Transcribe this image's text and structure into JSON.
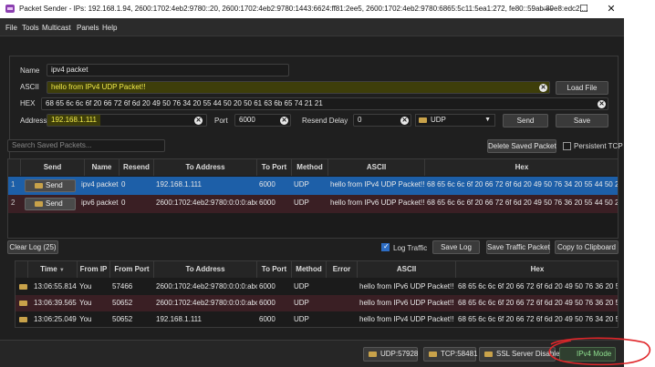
{
  "window": {
    "title": "Packet Sender - IPs: 192.168.1.94, 2600:1702:4eb2:9780::20, 2600:1702:4eb2:9780:1443:6624:ff81:2ee5, 2600:1702:4eb2:9780:6865:5c11:5ea1:272, fe80::59ab:89e8:edc2:...",
    "controls": {
      "minimize": "—",
      "maximize": "☐",
      "close": "✕"
    }
  },
  "menu": [
    "File",
    "Tools",
    "Multicast",
    "Panels",
    "Help"
  ],
  "form": {
    "name_label": "Name",
    "name_value": "ipv4 packet",
    "ascii_label": "ASCII",
    "ascii_value": "hello from IPv4 UDP Packet!!",
    "load_file": "Load File",
    "hex_label": "HEX",
    "hex_value": "68 65 6c 6c 6f 20 66 72 6f 6d 20 49 50 76 34 20 55 44 50 20 50 61 63 6b 65 74 21 21",
    "address_label": "Address",
    "address_value": "192.168.1.111",
    "port_label": "Port",
    "port_value": "6000",
    "resend_label": "Resend Delay",
    "resend_value": "0",
    "protocol": "UDP",
    "send": "Send",
    "save": "Save"
  },
  "saved": {
    "search_placeholder": "Search Saved Packets...",
    "delete_btn": "Delete Saved Packet",
    "persistent_label": "Persistent TCP",
    "headers": [
      "Send",
      "Name",
      "Resend",
      "To Address",
      "To Port",
      "Method",
      "ASCII",
      "Hex"
    ],
    "rows": [
      {
        "num": "1",
        "send": "Send",
        "name": "ipv4 packet",
        "resend": "0",
        "to": "192.168.1.111",
        "port": "6000",
        "method": "UDP",
        "ascii": "hello from IPv4 UDP Packet!!",
        "hex": "68 65 6c 6c 6f 20 66 72 6f 6d 20 49 50 76 34 20 55 44 50 20..."
      },
      {
        "num": "2",
        "send": "Send",
        "name": "ipv6 packet",
        "resend": "0",
        "to": "2600:1702:4eb2:9780:0:0:0:abcd",
        "port": "6000",
        "method": "UDP",
        "ascii": "hello from IPv6 UDP Packet!!",
        "hex": "68 65 6c 6c 6f 20 66 72 6f 6d 20 49 50 76 36 20 55 44 50 20 50 61 63"
      }
    ]
  },
  "traffic": {
    "clear_log": "Clear Log (25)",
    "log_traffic": "Log Traffic",
    "save_log": "Save Log",
    "save_traffic": "Save Traffic Packet",
    "copy": "Copy to Clipboard",
    "headers": [
      "Time",
      "From IP",
      "From Port",
      "To Address",
      "To Port",
      "Method",
      "Error",
      "ASCII",
      "Hex"
    ],
    "rows": [
      {
        "time": "13:06:55.814",
        "from": "You",
        "fport": "57466",
        "to": "2600:1702:4eb2:9780:0:0:0:abcd",
        "tport": "6000",
        "method": "UDP",
        "error": "",
        "ascii": "hello from IPv6 UDP Packet!!",
        "hex": "68 65 6c 6c 6f 20 66 72 6f 6d 20 49 50 76 36 20 55"
      },
      {
        "time": "13:06:39.565",
        "from": "You",
        "fport": "50652",
        "to": "2600:1702:4eb2:9780:0:0:0:abcd",
        "tport": "6000",
        "method": "UDP",
        "error": "",
        "ascii": "hello from IPv6 UDP Packet!!",
        "hex": "68 65 6c 6c 6f 20 66 72 6f 6d 20 49 50 76 36 20 55"
      },
      {
        "time": "13:06:25.049",
        "from": "You",
        "fport": "50652",
        "to": "192.168.1.111",
        "tport": "6000",
        "method": "UDP",
        "error": "",
        "ascii": "hello from IPv4 UDP Packet!!",
        "hex": "68 65 6c 6c 6f 20 66 72 6f 6d 20 49 50 76 34 20 55"
      }
    ]
  },
  "status": {
    "udp": "UDP:57928",
    "tcp": "TCP:58481",
    "ssl": "SSL Server Disabled",
    "mode": "IPv4 Mode"
  },
  "colors": {
    "selected_row": "#1d5fa8",
    "alt_row": "#3a1f24",
    "highlight": "#f2eb4a",
    "annotation": "#e0262a",
    "mode_green": "#4ad06a"
  }
}
